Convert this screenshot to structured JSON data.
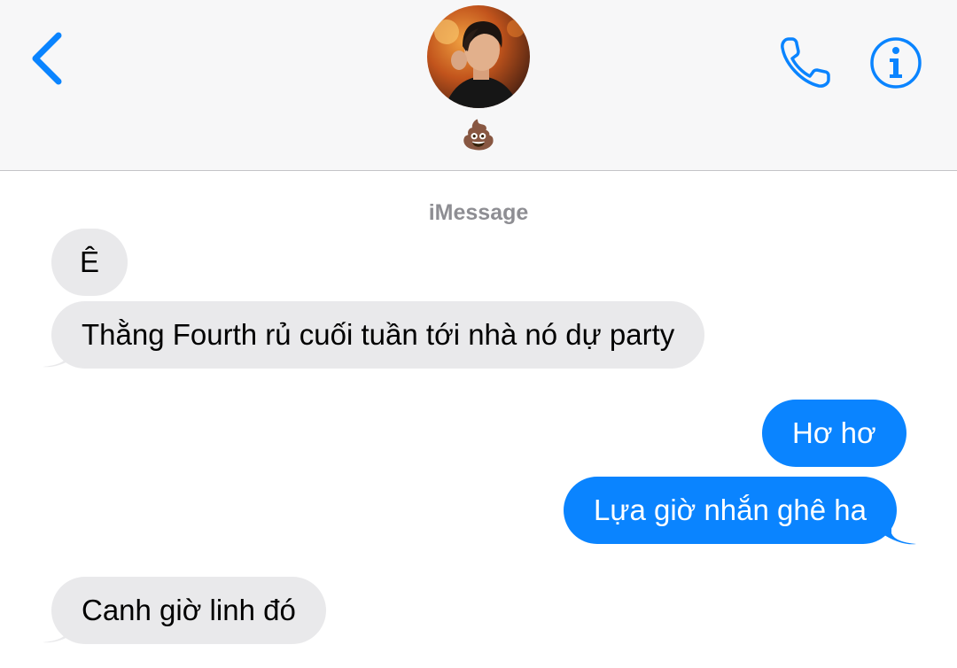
{
  "header": {
    "contact_name": "💩",
    "accent_color": "#0a84ff",
    "icons": {
      "back": "chevron-left-icon",
      "phone": "phone-icon",
      "info": "info-icon"
    }
  },
  "conversation": {
    "service_label": "iMessage",
    "messages": [
      {
        "direction": "incoming",
        "text": "Ê"
      },
      {
        "direction": "incoming",
        "text": "Thằng Fourth rủ cuối tuần tới nhà nó dự party"
      },
      {
        "direction": "outgoing",
        "text": "Hơ hơ"
      },
      {
        "direction": "outgoing",
        "text": "Lựa giờ nhắn ghê ha"
      },
      {
        "direction": "incoming",
        "text": "Canh giờ linh đó"
      }
    ],
    "colors": {
      "incoming_bubble": "#e9e9eb",
      "outgoing_bubble": "#0a84ff",
      "service_label": "#8e8e93"
    }
  }
}
